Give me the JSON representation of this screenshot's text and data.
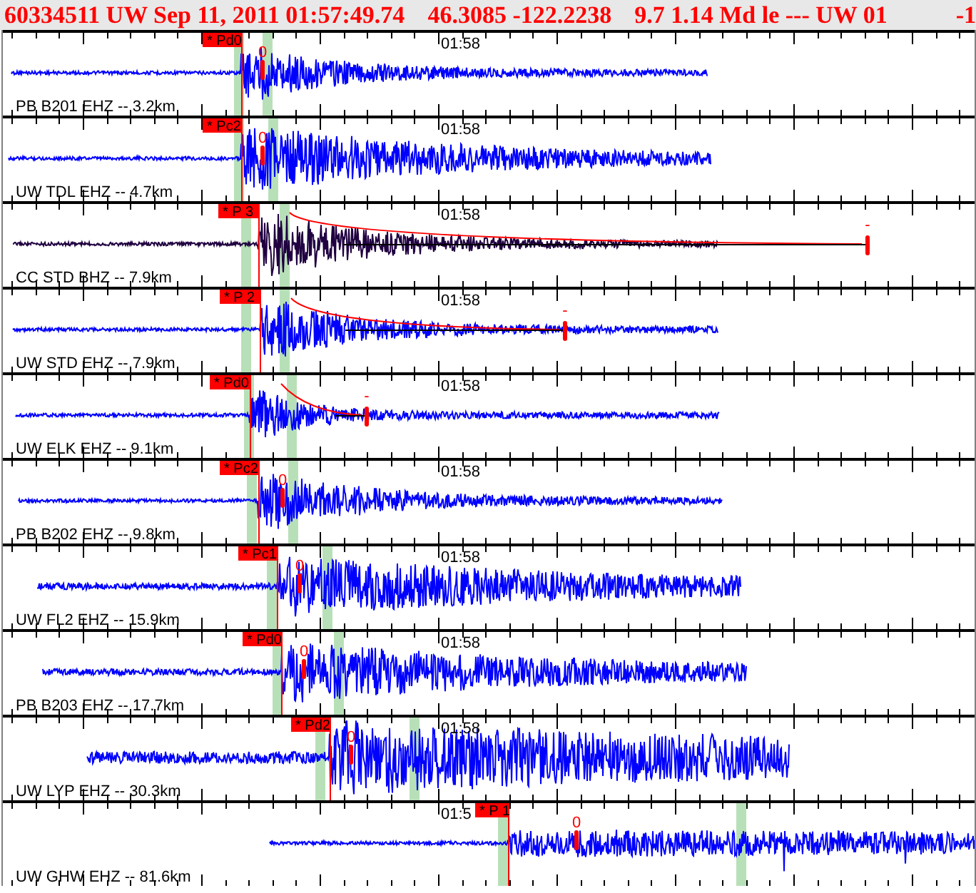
{
  "header": {
    "fields": [
      "60334511 UW Sep 11, 2011 01:57:49.74",
      "46.3085 -122.2238",
      "9.7 1.14 Md le --- UW 01",
      "-1"
    ]
  },
  "traces": [
    {
      "station": "PB B201 EHZ -- 3.2km",
      "time_label": "01:58",
      "pick": "* Pd0",
      "marker": "0",
      "color": "#0000ff"
    },
    {
      "station": "UW TDL EHZ -- 4.7km",
      "time_label": "01:58",
      "pick": "* Pc2",
      "marker": "0",
      "color": "#0000ff"
    },
    {
      "station": "CC STD BHZ -- 7.9km",
      "time_label": "01:58",
      "pick": "* P 3",
      "marker": "-",
      "color": "#200040"
    },
    {
      "station": "UW STD EHZ -- 7.9km",
      "time_label": "01:58",
      "pick": "* P 2",
      "marker": "-",
      "color": "#0000ff"
    },
    {
      "station": "UW ELK EHZ -- 9.1km",
      "time_label": "01:58",
      "pick": "* Pd0",
      "marker": "-",
      "color": "#0000ff"
    },
    {
      "station": "PB B202 EHZ -- 9.8km",
      "time_label": "01:58",
      "pick": "* Pc2",
      "marker": "0",
      "color": "#0000ff"
    },
    {
      "station": "UW FL2 EHZ -- 15.9km",
      "time_label": "01:58",
      "pick": "* Pc1",
      "marker": "0",
      "color": "#0000ff"
    },
    {
      "station": "PB B203 EHZ -- 17.7km",
      "time_label": "01:58",
      "pick": "* Pd0",
      "marker": "0",
      "color": "#0000ff"
    },
    {
      "station": "UW LYP EHZ -- 30.3km",
      "time_label": "01:58",
      "pick": "* Pd2",
      "marker": "0",
      "color": "#0000ff"
    },
    {
      "station": "UW GHW EHZ -- 81.6km",
      "time_label": "01:5",
      "pick": "* P 1",
      "marker": "0",
      "color": "#0000ff"
    }
  ]
}
